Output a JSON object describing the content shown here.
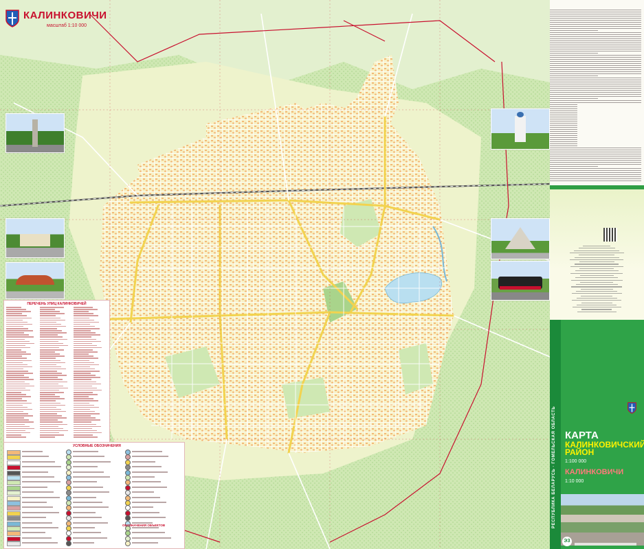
{
  "map": {
    "city_title": "КАЛИНКОВИЧИ",
    "scale_small": "масштаб 1:10 000",
    "street_index_header": "ПЕРЕЧЕНЬ УЛИЦ КАЛИНКОВИЧЕЙ",
    "legend_header": "УСЛОВНЫЕ ОБОЗНАЧЕНИЯ",
    "legend_lower_header": "ОБОЗНАЧЕНИЯ ОБЪЕКТОВ",
    "colors": {
      "land": "#f7f2c6",
      "forest": "#cfe8b3",
      "forest_dark": "#a9d48b",
      "water": "#b9dff0",
      "road_major": "#f2d34f",
      "road_minor": "#ffffff",
      "building": "#f3b979",
      "boundary": "#c8102e",
      "railway": "#555555"
    }
  },
  "cover": {
    "karta": "КАРТА",
    "district": "КАЛИНКОВИЧСКИЙ РАЙОН",
    "scale_district": "1:100 000",
    "city": "КАЛИНКОВИЧИ",
    "scale_city": "1:10 000",
    "side_text": "РЕСПУБЛИКА БЕЛАРУСЬ · ГОМЕЛЬСКАЯ ОБЛАСТЬ",
    "colors": {
      "green": "#2fa348",
      "dark_green": "#1b8a3a",
      "yellow": "#fff200",
      "red": "#ff7b7b"
    }
  }
}
